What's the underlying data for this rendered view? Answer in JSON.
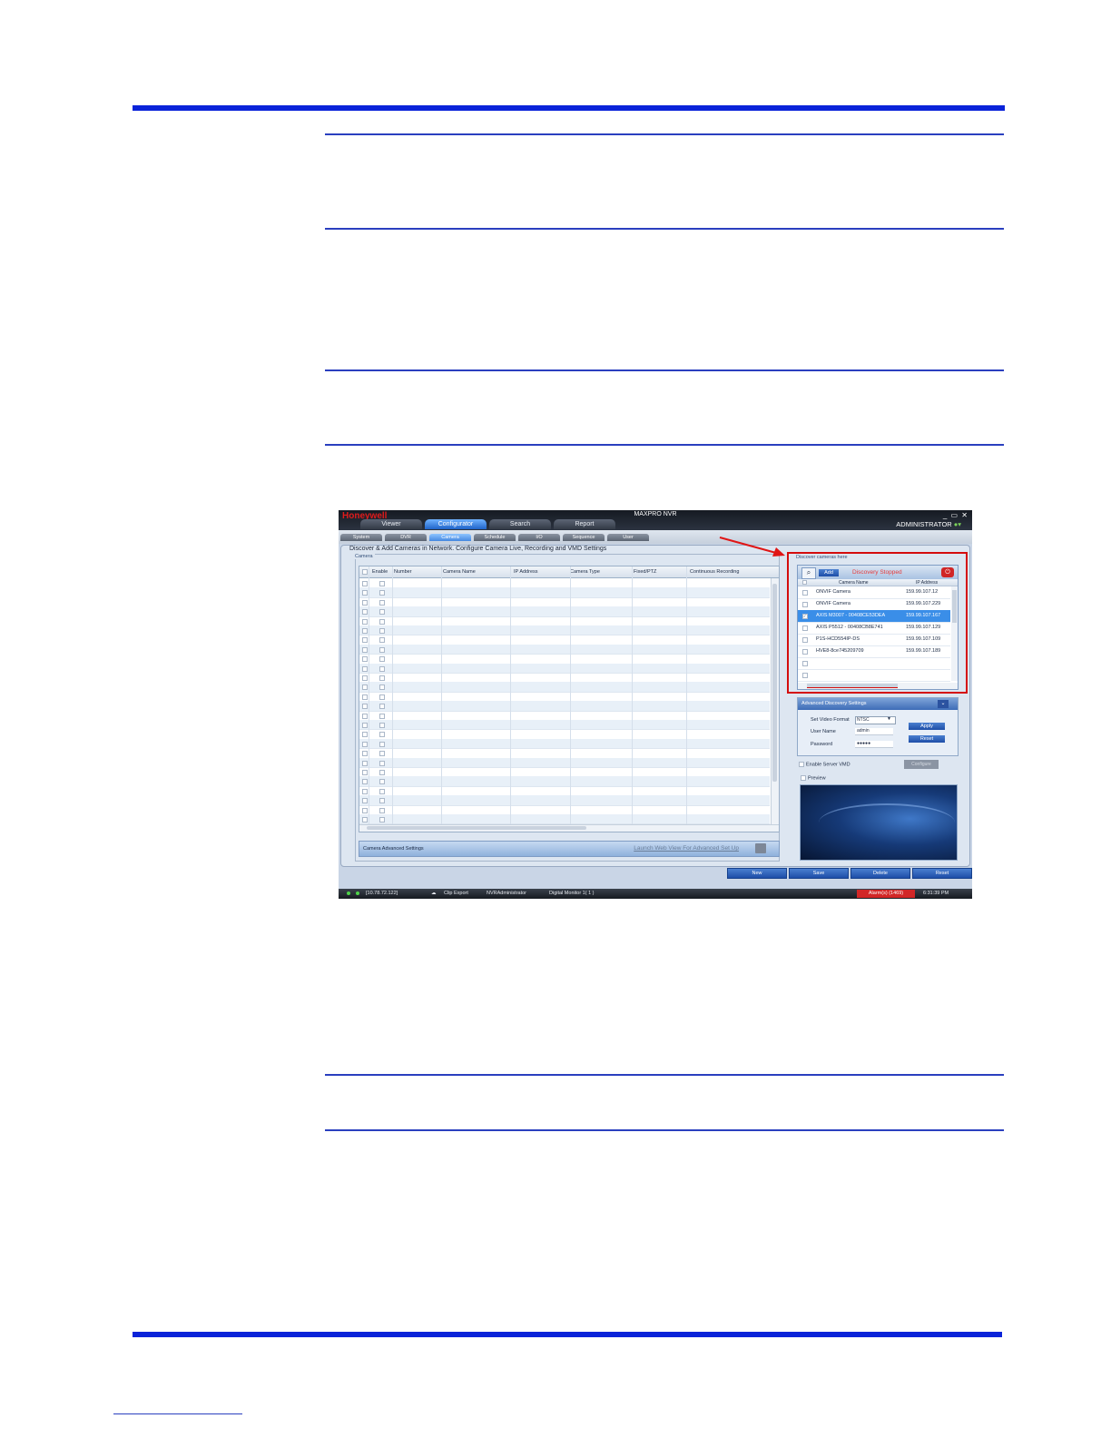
{
  "app": {
    "brand": "Honeywell",
    "title": "MAXPRO NVR",
    "window_controls": "_ ▭ ✕",
    "main_tabs": [
      {
        "label": "Viewer",
        "active": false
      },
      {
        "label": "Configurator",
        "active": true
      },
      {
        "label": "Search",
        "active": false
      },
      {
        "label": "Report",
        "active": false
      }
    ],
    "user": "ADMINISTRATOR",
    "sub_tabs": [
      {
        "label": "System",
        "active": false
      },
      {
        "label": "DVR",
        "active": false
      },
      {
        "label": "Camera",
        "active": true
      },
      {
        "label": "Schedule",
        "active": false
      },
      {
        "label": "I/O",
        "active": false
      },
      {
        "label": "Sequence",
        "active": false
      },
      {
        "label": "User",
        "active": false
      }
    ]
  },
  "panel": {
    "title": "Discover & Add Cameras in Network. Configure Camera Live, Recording and VMD Settings",
    "camera_group_label": "Camera",
    "grid_columns": [
      "Enable",
      "Number",
      "Camera Name",
      "IP Address",
      "Camera Type",
      "Fixed/PTZ",
      "Continuous Recording"
    ],
    "grid_row_count": 26,
    "advanced_bar_label": "Camera Advanced Settings",
    "advanced_bar_link": "Launch Web View For Advanced Set Up"
  },
  "discovery": {
    "label": "Discover cameras here",
    "add_label": "Add",
    "status": "Discovery Stopped",
    "columns": [
      "Camera Name",
      "IP Address"
    ],
    "rows": [
      {
        "name": "ONVIF Camera",
        "ip": "159.99.107.12",
        "checked": false,
        "selected": false
      },
      {
        "name": "ONVIF Camera",
        "ip": "159.99.107.229",
        "checked": false,
        "selected": false
      },
      {
        "name": "AXIS M3007 - 00408CE53DEA",
        "ip": "159.99.107.167",
        "checked": true,
        "selected": true
      },
      {
        "name": "AXIS P5512 - 00408CB8E741",
        "ip": "159.99.107.129",
        "checked": false,
        "selected": false
      },
      {
        "name": "P1S-HCD554IP-DS",
        "ip": "159.99.107.109",
        "checked": false,
        "selected": false
      },
      {
        "name": "HVE8-8ce745209709",
        "ip": "159.99.107.189",
        "checked": false,
        "selected": false
      },
      {
        "name": "",
        "ip": "",
        "checked": false,
        "selected": false
      },
      {
        "name": "",
        "ip": "",
        "checked": false,
        "selected": false
      }
    ]
  },
  "advanced_discovery": {
    "title": "Advanced Discovery Settings",
    "video_format_label": "Set Video Format",
    "video_format_value": "NTSC",
    "username_label": "User Name",
    "username_value": "admin",
    "password_label": "Password",
    "password_value": "●●●●●",
    "apply_label": "Apply",
    "reset_label": "Reset"
  },
  "server_vmd": {
    "label": "Enable Server VMD",
    "configure_label": "Configure"
  },
  "preview": {
    "label": "Preview"
  },
  "actions": {
    "new": "New",
    "save": "Save",
    "delete": "Delete",
    "reset": "Reset"
  },
  "status_bar": {
    "ip": "[10.78.72.122]",
    "clip_export": "Clip Export",
    "user": "NVRAdministrator",
    "monitor": "Digital Monitor 1( 1 )",
    "alarms": "Alarm(s) (1469)",
    "time": "6:31:39 PM"
  },
  "colors": {
    "rule": "#2a3fbf",
    "thick_rule": "#0a23d9",
    "highlight": "#d40d0d",
    "active_tab": "#1f63c9"
  }
}
